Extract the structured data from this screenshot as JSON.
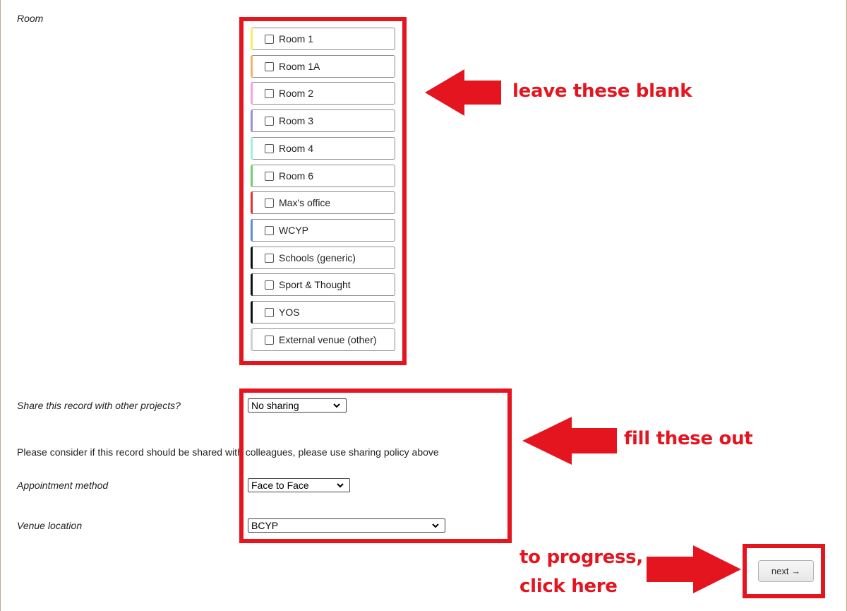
{
  "room": {
    "label": "Room",
    "items": [
      {
        "label": "Room 1",
        "color": "#f5f06a"
      },
      {
        "label": "Room 1A",
        "color": "#f3b366"
      },
      {
        "label": "Room 2",
        "color": "#f5a3e0"
      },
      {
        "label": "Room 3",
        "color": "#9a8fd8"
      },
      {
        "label": "Room 4",
        "color": "#9ff0e4"
      },
      {
        "label": "Room 6",
        "color": "#6fd06f"
      },
      {
        "label": "Max's office",
        "color": "#e33232"
      },
      {
        "label": "WCYP",
        "color": "#5a8ee0"
      },
      {
        "label": "Schools (generic)",
        "color": "#111111"
      },
      {
        "label": "Sport & Thought",
        "color": "#111111"
      },
      {
        "label": "YOS",
        "color": "#111111"
      },
      {
        "label": "External venue (other)",
        "color": "#d0d0d0"
      }
    ]
  },
  "share": {
    "label": "Share this record with other projects?",
    "value": "No sharing"
  },
  "note": "Please consider if this record should be shared with colleagues, please use sharing policy above",
  "appointment": {
    "label": "Appointment method",
    "value": "Face to Face"
  },
  "venue": {
    "label": "Venue location",
    "value": "BCYP"
  },
  "next_button": "next →",
  "annotations": {
    "blank": "leave these blank",
    "fill": "fill these out",
    "progress_line1": "to progress,",
    "progress_line2": "click here",
    "color": "#e4151f"
  }
}
